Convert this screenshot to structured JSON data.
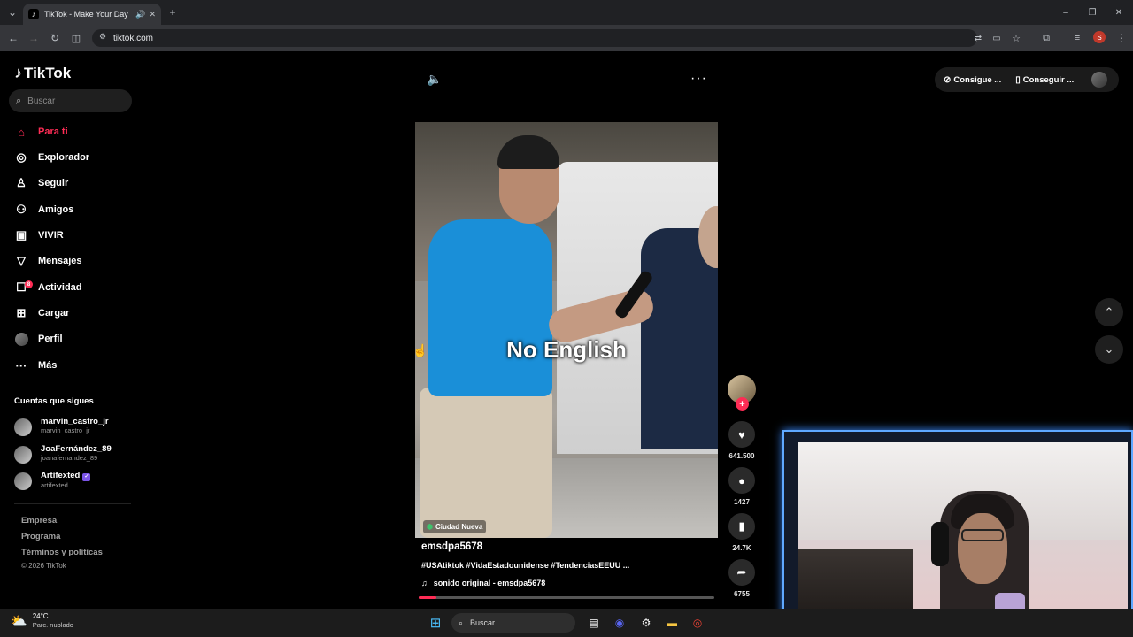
{
  "browser": {
    "tab_title": "TikTok - Make Your Day",
    "url": "tiktok.com",
    "profile_initial": "S"
  },
  "sidebar": {
    "logo": "TikTok",
    "search_placeholder": "Buscar",
    "items": [
      {
        "label": "Para ti",
        "icon": "home-icon"
      },
      {
        "label": "Explorador",
        "icon": "compass-icon"
      },
      {
        "label": "Seguir",
        "icon": "user-follow-icon"
      },
      {
        "label": "Amigos",
        "icon": "friends-icon"
      },
      {
        "label": "VIVIR",
        "icon": "live-icon"
      },
      {
        "label": "Mensajes",
        "icon": "send-icon"
      },
      {
        "label": "Actividad",
        "icon": "inbox-icon",
        "badge": "8"
      },
      {
        "label": "Cargar",
        "icon": "upload-icon"
      },
      {
        "label": "Perfil",
        "icon": "avatar-icon"
      },
      {
        "label": "Más",
        "icon": "more-icon"
      }
    ],
    "following_title": "Cuentas que sigues",
    "following": [
      {
        "name": "marvin_castro_jr",
        "handle": "marvin_castro_jr"
      },
      {
        "name": "JoaFernández_89",
        "handle": "joanafernandez_89"
      },
      {
        "name": "Artifexted",
        "handle": "artifexted"
      }
    ],
    "footer": [
      "Empresa",
      "Programa",
      "Términos y políticas"
    ],
    "copyright": "© 2026 TikTok"
  },
  "topbar": {
    "get_coins": "Consigue ...",
    "get_app": "Conseguir ..."
  },
  "video": {
    "caption_overlay": "No English",
    "location": "Ciudad Nueva",
    "author": "emsdpa5678",
    "description": "#USAtiktok #VidaEstadounidense #TendenciasEEUU ...",
    "sound": "sonido original - emsdpa5678",
    "progress_percent": 6
  },
  "actions": {
    "likes": "641.500",
    "comments": "1427",
    "saves": "24.7K",
    "shares": "6755"
  },
  "taskbar": {
    "temp": "24°C",
    "weather": "Parc. nublado",
    "search": "Buscar"
  }
}
